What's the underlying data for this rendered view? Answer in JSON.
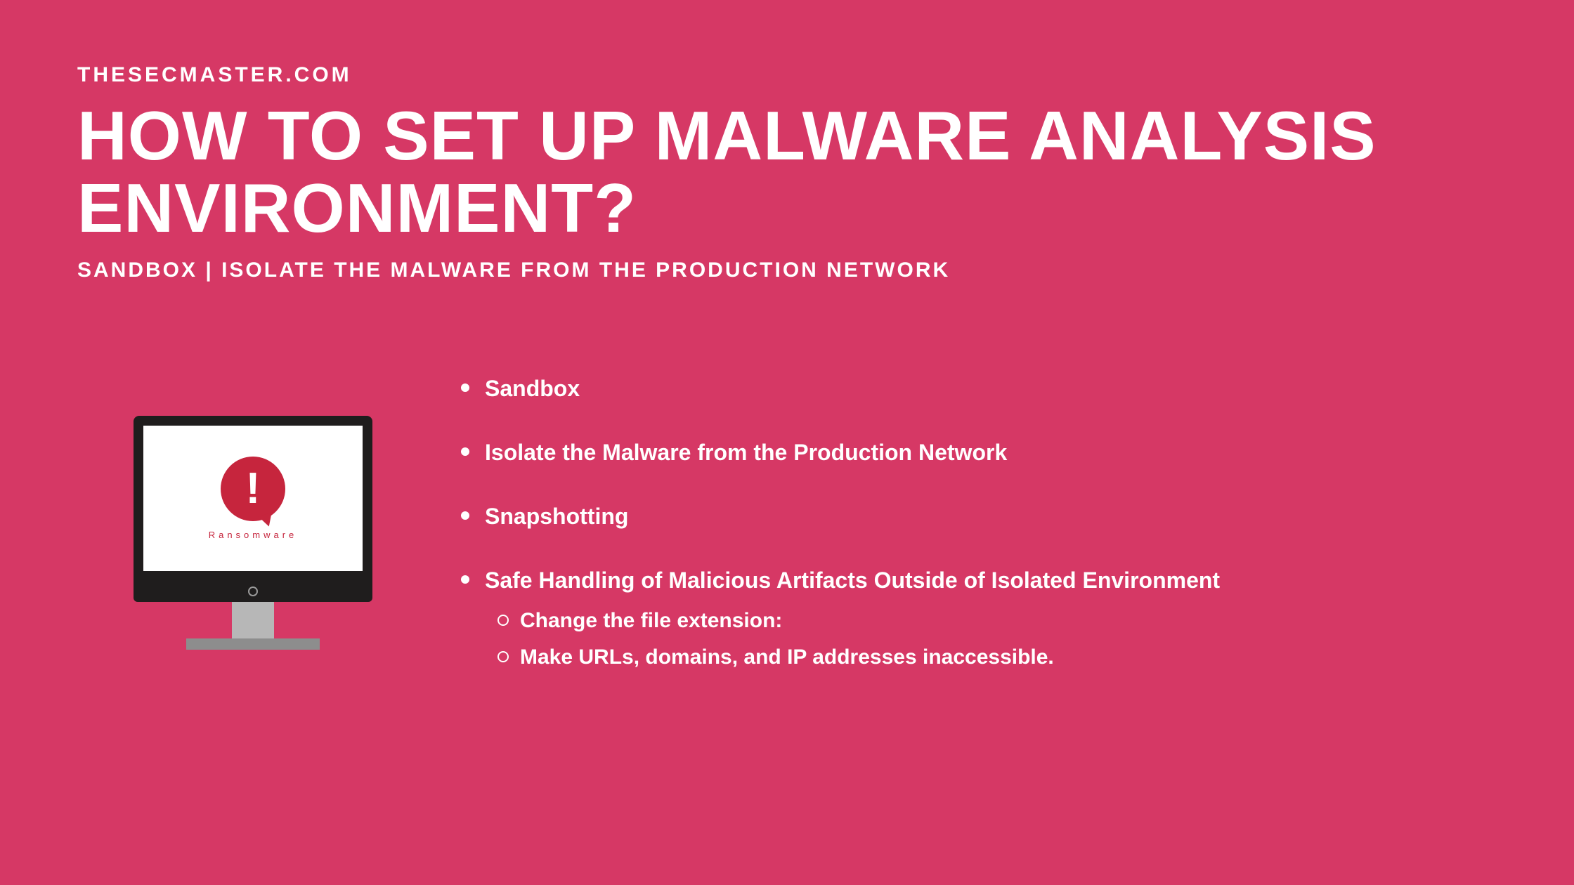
{
  "site": "THESECMASTER.COM",
  "title": "HOW TO SET UP MALWARE ANALYSIS ENVIRONMENT?",
  "subtitle": "SANDBOX | ISOLATE THE MALWARE FROM THE PRODUCTION NETWORK",
  "monitor": {
    "exclaim": "!",
    "label": "Ransomware"
  },
  "bullets": [
    {
      "text": "Sandbox"
    },
    {
      "text": "Isolate the Malware from the Production Network"
    },
    {
      "text": "Snapshotting"
    },
    {
      "text": "Safe Handling of Malicious Artifacts Outside of Isolated Environment",
      "sub": [
        "Change the file extension:",
        "Make URLs, domains, and IP addresses inaccessible."
      ]
    }
  ]
}
